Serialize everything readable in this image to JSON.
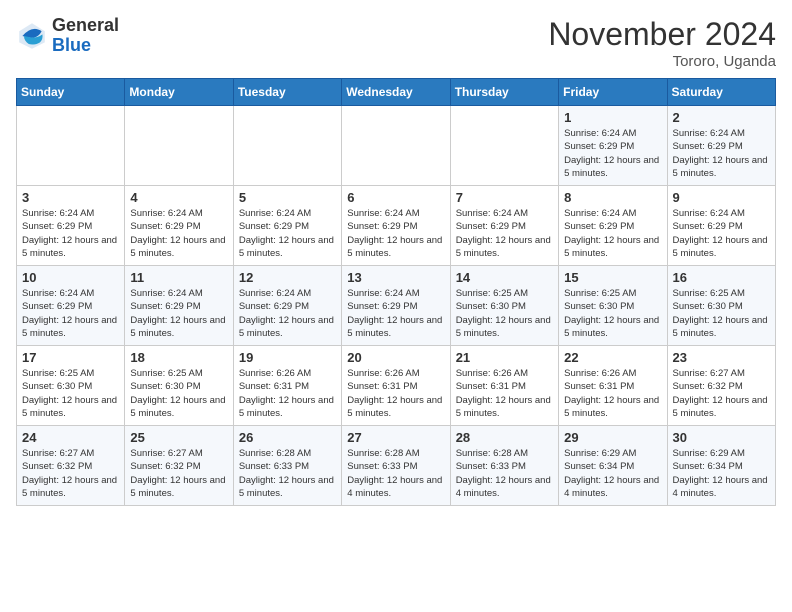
{
  "logo": {
    "general": "General",
    "blue": "Blue"
  },
  "title": "November 2024",
  "location": "Tororo, Uganda",
  "days_of_week": [
    "Sunday",
    "Monday",
    "Tuesday",
    "Wednesday",
    "Thursday",
    "Friday",
    "Saturday"
  ],
  "weeks": [
    [
      {
        "num": "",
        "info": ""
      },
      {
        "num": "",
        "info": ""
      },
      {
        "num": "",
        "info": ""
      },
      {
        "num": "",
        "info": ""
      },
      {
        "num": "",
        "info": ""
      },
      {
        "num": "1",
        "info": "Sunrise: 6:24 AM\nSunset: 6:29 PM\nDaylight: 12 hours and 5 minutes."
      },
      {
        "num": "2",
        "info": "Sunrise: 6:24 AM\nSunset: 6:29 PM\nDaylight: 12 hours and 5 minutes."
      }
    ],
    [
      {
        "num": "3",
        "info": "Sunrise: 6:24 AM\nSunset: 6:29 PM\nDaylight: 12 hours and 5 minutes."
      },
      {
        "num": "4",
        "info": "Sunrise: 6:24 AM\nSunset: 6:29 PM\nDaylight: 12 hours and 5 minutes."
      },
      {
        "num": "5",
        "info": "Sunrise: 6:24 AM\nSunset: 6:29 PM\nDaylight: 12 hours and 5 minutes."
      },
      {
        "num": "6",
        "info": "Sunrise: 6:24 AM\nSunset: 6:29 PM\nDaylight: 12 hours and 5 minutes."
      },
      {
        "num": "7",
        "info": "Sunrise: 6:24 AM\nSunset: 6:29 PM\nDaylight: 12 hours and 5 minutes."
      },
      {
        "num": "8",
        "info": "Sunrise: 6:24 AM\nSunset: 6:29 PM\nDaylight: 12 hours and 5 minutes."
      },
      {
        "num": "9",
        "info": "Sunrise: 6:24 AM\nSunset: 6:29 PM\nDaylight: 12 hours and 5 minutes."
      }
    ],
    [
      {
        "num": "10",
        "info": "Sunrise: 6:24 AM\nSunset: 6:29 PM\nDaylight: 12 hours and 5 minutes."
      },
      {
        "num": "11",
        "info": "Sunrise: 6:24 AM\nSunset: 6:29 PM\nDaylight: 12 hours and 5 minutes."
      },
      {
        "num": "12",
        "info": "Sunrise: 6:24 AM\nSunset: 6:29 PM\nDaylight: 12 hours and 5 minutes."
      },
      {
        "num": "13",
        "info": "Sunrise: 6:24 AM\nSunset: 6:29 PM\nDaylight: 12 hours and 5 minutes."
      },
      {
        "num": "14",
        "info": "Sunrise: 6:25 AM\nSunset: 6:30 PM\nDaylight: 12 hours and 5 minutes."
      },
      {
        "num": "15",
        "info": "Sunrise: 6:25 AM\nSunset: 6:30 PM\nDaylight: 12 hours and 5 minutes."
      },
      {
        "num": "16",
        "info": "Sunrise: 6:25 AM\nSunset: 6:30 PM\nDaylight: 12 hours and 5 minutes."
      }
    ],
    [
      {
        "num": "17",
        "info": "Sunrise: 6:25 AM\nSunset: 6:30 PM\nDaylight: 12 hours and 5 minutes."
      },
      {
        "num": "18",
        "info": "Sunrise: 6:25 AM\nSunset: 6:30 PM\nDaylight: 12 hours and 5 minutes."
      },
      {
        "num": "19",
        "info": "Sunrise: 6:26 AM\nSunset: 6:31 PM\nDaylight: 12 hours and 5 minutes."
      },
      {
        "num": "20",
        "info": "Sunrise: 6:26 AM\nSunset: 6:31 PM\nDaylight: 12 hours and 5 minutes."
      },
      {
        "num": "21",
        "info": "Sunrise: 6:26 AM\nSunset: 6:31 PM\nDaylight: 12 hours and 5 minutes."
      },
      {
        "num": "22",
        "info": "Sunrise: 6:26 AM\nSunset: 6:31 PM\nDaylight: 12 hours and 5 minutes."
      },
      {
        "num": "23",
        "info": "Sunrise: 6:27 AM\nSunset: 6:32 PM\nDaylight: 12 hours and 5 minutes."
      }
    ],
    [
      {
        "num": "24",
        "info": "Sunrise: 6:27 AM\nSunset: 6:32 PM\nDaylight: 12 hours and 5 minutes."
      },
      {
        "num": "25",
        "info": "Sunrise: 6:27 AM\nSunset: 6:32 PM\nDaylight: 12 hours and 5 minutes."
      },
      {
        "num": "26",
        "info": "Sunrise: 6:28 AM\nSunset: 6:33 PM\nDaylight: 12 hours and 5 minutes."
      },
      {
        "num": "27",
        "info": "Sunrise: 6:28 AM\nSunset: 6:33 PM\nDaylight: 12 hours and 4 minutes."
      },
      {
        "num": "28",
        "info": "Sunrise: 6:28 AM\nSunset: 6:33 PM\nDaylight: 12 hours and 4 minutes."
      },
      {
        "num": "29",
        "info": "Sunrise: 6:29 AM\nSunset: 6:34 PM\nDaylight: 12 hours and 4 minutes."
      },
      {
        "num": "30",
        "info": "Sunrise: 6:29 AM\nSunset: 6:34 PM\nDaylight: 12 hours and 4 minutes."
      }
    ]
  ]
}
